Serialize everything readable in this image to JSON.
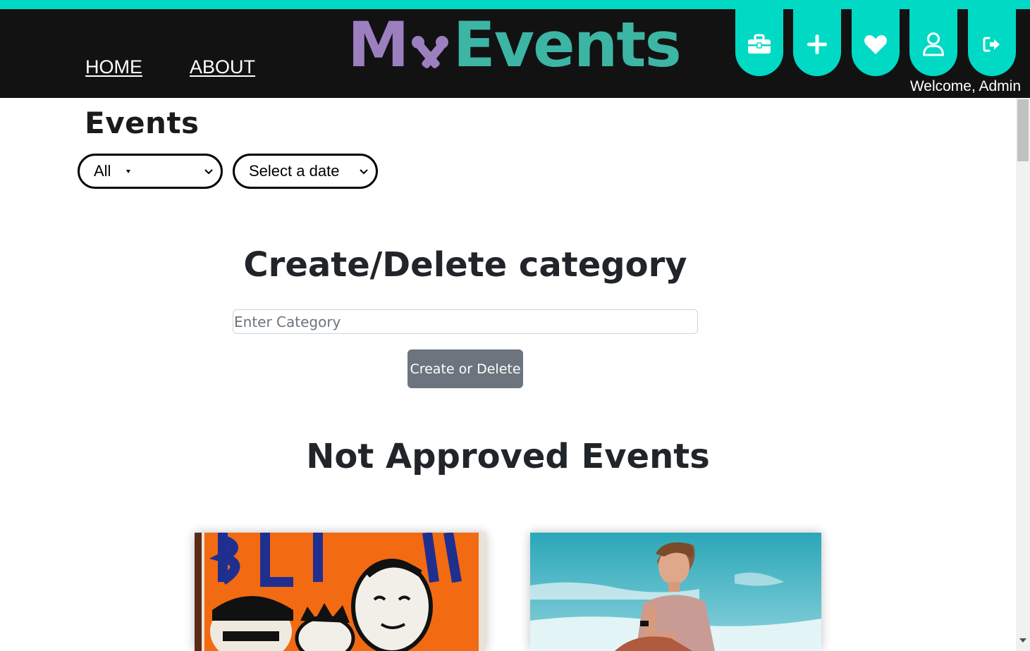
{
  "header": {
    "nav": [
      {
        "label": "HOME"
      },
      {
        "label": "ABOUT"
      }
    ],
    "logo": {
      "part1": "M",
      "part2": "Events"
    },
    "icon_tabs": [
      {
        "icon": "toolbox-icon"
      },
      {
        "icon": "plus-icon"
      },
      {
        "icon": "heart-icon"
      },
      {
        "icon": "user-icon"
      },
      {
        "icon": "logout-icon"
      }
    ],
    "welcome": "Welcome, Admin"
  },
  "colors": {
    "accent": "#00d9c4",
    "header_bg": "#121212",
    "logo_purple": "#9b7fbf",
    "logo_teal": "#3db5a5",
    "button_gray": "#6c757d"
  },
  "page": {
    "title": "Events",
    "filters": {
      "category_selected": "All",
      "date_selected": "Select a date"
    }
  },
  "category_form": {
    "title": "Create/Delete category",
    "placeholder": "Enter Category",
    "value": "",
    "button_label": "Create or Delete"
  },
  "not_approved": {
    "title": "Not Approved Events",
    "cards": [
      {
        "image": "blink-182-poster"
      },
      {
        "image": "man-sitting-beach-sky"
      }
    ]
  }
}
